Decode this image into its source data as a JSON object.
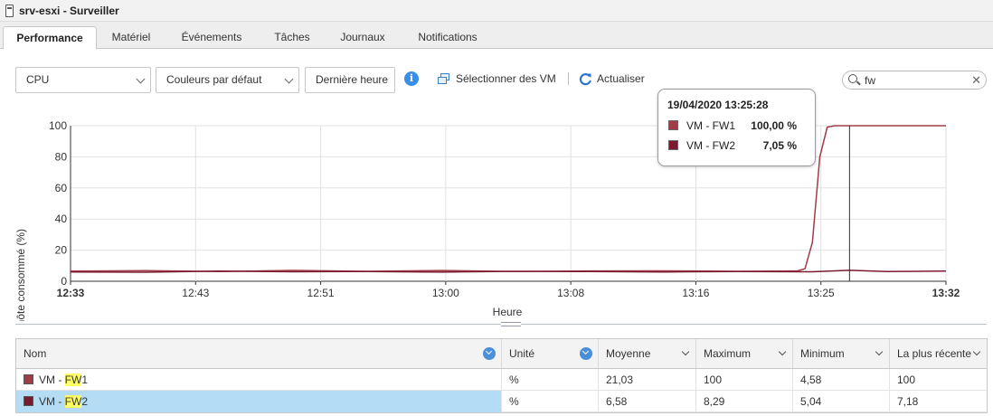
{
  "window": {
    "title": "srv-esxi - Surveiller"
  },
  "tabs": [
    "Performance",
    "Matériel",
    "Événements",
    "Tâches",
    "Journaux",
    "Notifications"
  ],
  "toolbar": {
    "metric": "CPU",
    "colors": "Couleurs par défaut",
    "period": "Dernière heure",
    "select_vms": "Sélectionner des VM",
    "refresh": "Actualiser",
    "search_value": "fw"
  },
  "chart_data": {
    "type": "line",
    "ylabel": "CPU hôte consommé (%)",
    "xlabel": "Heure",
    "ylim": [
      0,
      100
    ],
    "yticks": [
      "100",
      "80",
      "60",
      "40",
      "20",
      "0"
    ],
    "xticks": [
      {
        "label": "12:33",
        "bold": true
      },
      {
        "label": "12:43",
        "bold": false
      },
      {
        "label": "12:51",
        "bold": false
      },
      {
        "label": "13:00",
        "bold": false
      },
      {
        "label": "13:08",
        "bold": false
      },
      {
        "label": "13:16",
        "bold": false
      },
      {
        "label": "13:25",
        "bold": false
      },
      {
        "label": "13:32",
        "bold": true
      }
    ],
    "xrange_min": [
      0,
      59
    ],
    "hover_min": 52.5,
    "series": [
      {
        "name": "VM - FW1",
        "color": "#a13b46",
        "x": [
          0,
          5,
          10,
          15,
          20,
          25,
          30,
          35,
          40,
          45,
          48,
          49,
          49.5,
          50,
          50.5,
          51,
          51.5,
          52.5,
          55,
          59
        ],
        "y": [
          6.5,
          6.8,
          6.2,
          7,
          6.4,
          6.9,
          6.3,
          6.6,
          6.7,
          6.4,
          6.5,
          6.7,
          8,
          25,
          80,
          99,
          100,
          100,
          100,
          100
        ]
      },
      {
        "name": "VM - FW2",
        "color": "#7a1a30",
        "x": [
          0,
          5,
          10,
          15,
          20,
          25,
          30,
          35,
          40,
          45,
          50,
          52.5,
          55,
          59
        ],
        "y": [
          6.0,
          5.8,
          6.5,
          6.1,
          6.3,
          5.9,
          6.4,
          6.2,
          6.0,
          6.3,
          6.1,
          7.05,
          6.2,
          6.5
        ]
      }
    ]
  },
  "tooltip": {
    "time": "19/04/2020 13:25:28",
    "rows": [
      {
        "name": "VM - FW1",
        "value": "100,00 %",
        "color": "#a13b46"
      },
      {
        "name": "VM - FW2",
        "value": "7,05 %",
        "color": "#7a1a30"
      }
    ]
  },
  "table": {
    "headers": [
      "Nom",
      "Unité",
      "Moyenne",
      "Maximum",
      "Minimum",
      "La plus récente"
    ],
    "rows": [
      {
        "name_prefix": "VM - ",
        "name_hl": "FW",
        "name_suffix": "1",
        "color": "#a13b46",
        "unit": "%",
        "avg": "21,03",
        "max": "100",
        "min": "4,58",
        "latest": "100",
        "selected": false
      },
      {
        "name_prefix": "VM - ",
        "name_hl": "FW",
        "name_suffix": "2",
        "color": "#7a1a30",
        "unit": "%",
        "avg": "6,58",
        "max": "8,29",
        "min": "5,04",
        "latest": "7,18",
        "selected": true
      }
    ]
  }
}
